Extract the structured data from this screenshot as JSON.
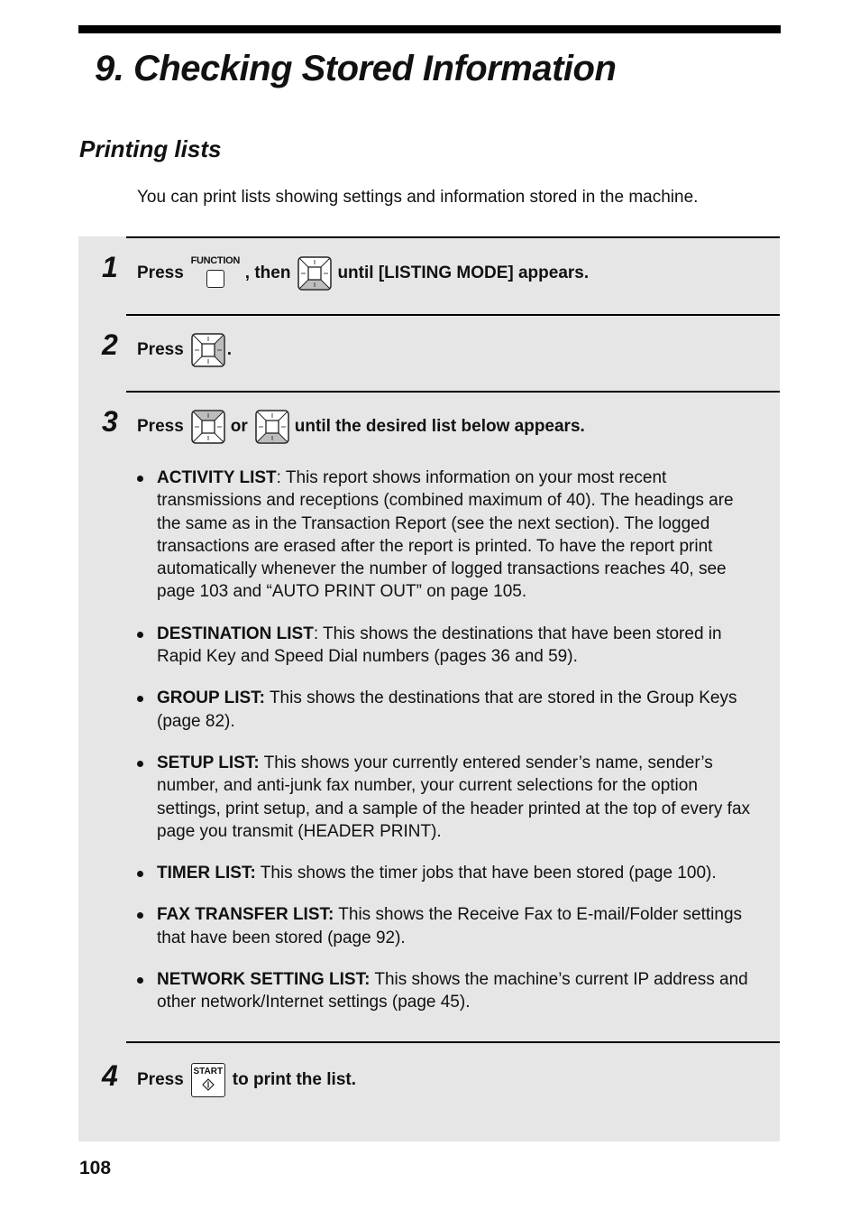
{
  "chapter_title": "9.  Checking Stored Information",
  "section_title": "Printing lists",
  "intro": "You can print lists showing settings and information stored in the machine.",
  "keys": {
    "function_label": "FUNCTION",
    "start_label": "START"
  },
  "steps": [
    {
      "number": "1",
      "parts": [
        "Press",
        ", then",
        "until [LISTING MODE] appears."
      ],
      "icons": [
        "function-key",
        "nav-key-down"
      ]
    },
    {
      "number": "2",
      "parts": [
        "Press",
        "."
      ],
      "icons": [
        "nav-key-right"
      ]
    },
    {
      "number": "3",
      "parts": [
        "Press",
        "or",
        "until the desired list below appears."
      ],
      "icons": [
        "nav-key-up",
        "nav-key-down"
      ],
      "list_items": [
        {
          "term": "ACTIVITY LIST",
          "sep": ": ",
          "text": "This report shows information on your most recent transmissions and receptions (combined maximum of 40). The headings are the same as in the Transaction Report (see the next section). The logged transactions are erased after the report is printed. To have the report print automatically whenever the number of logged transactions reaches 40, see page 103 and “AUTO PRINT OUT” on page 105."
        },
        {
          "term": "DESTINATION LIST",
          "sep": ": ",
          "text": "This shows the destinations that have been stored in Rapid Key and Speed Dial numbers (pages 36 and 59)."
        },
        {
          "term": "GROUP LIST:",
          "sep": " ",
          "text": "This shows the destinations that are stored in the Group Keys (page 82)."
        },
        {
          "term": "SETUP LIST:",
          "sep": " ",
          "text": "This shows your currently entered sender’s name, sender’s number, and anti-junk fax number, your current selections for the option settings, print setup, and a sample of the header printed at the top of every fax page you transmit (HEADER PRINT)."
        },
        {
          "term": "TIMER LIST:",
          "sep": " ",
          "text": "This shows the timer jobs that have been stored (page 100)."
        },
        {
          "term": "FAX TRANSFER LIST:",
          "sep": " ",
          "text": "This shows the Receive Fax to E-mail/Folder settings that have been stored (page 92)."
        },
        {
          "term": "NETWORK SETTING LIST:",
          "sep": " ",
          "text": "This shows the machine’s current IP address and other network/Internet settings (page 45)."
        }
      ]
    },
    {
      "number": "4",
      "parts": [
        "Press",
        "to print the list."
      ],
      "icons": [
        "start-key"
      ]
    }
  ],
  "page_number": "108"
}
